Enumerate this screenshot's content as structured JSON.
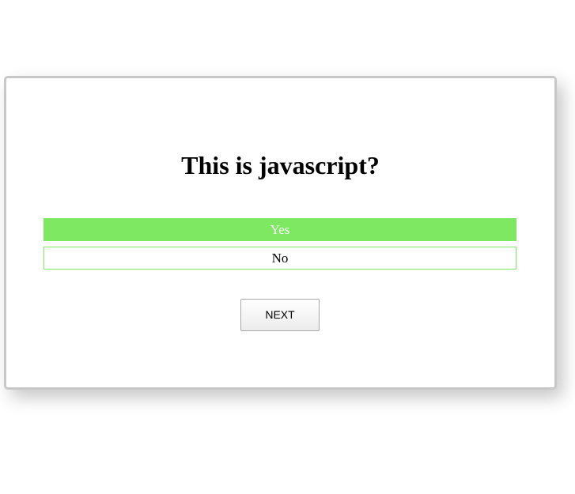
{
  "quiz": {
    "question": "This is javascript?",
    "options": [
      {
        "label": "Yes",
        "selected": true
      },
      {
        "label": "No",
        "selected": false
      }
    ],
    "next_label": "NEXT"
  },
  "colors": {
    "accent": "#7ee862",
    "border": "#c8c8c8"
  }
}
